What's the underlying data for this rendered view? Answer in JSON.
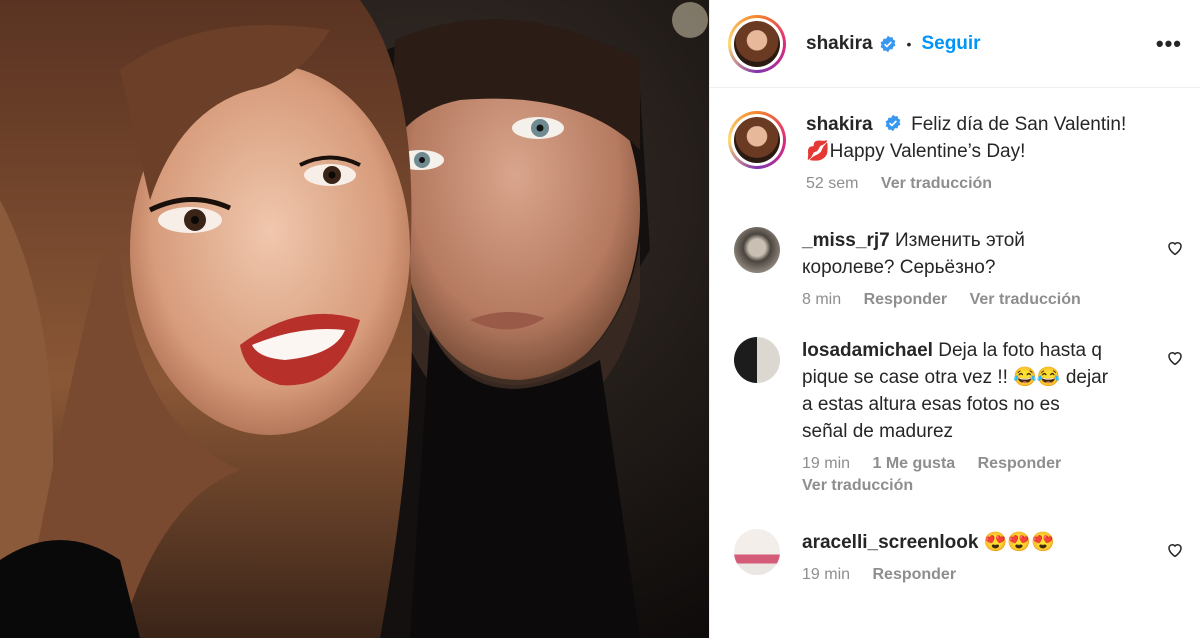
{
  "post": {
    "username": "shakira",
    "follow_label": "Seguir",
    "separator": "•",
    "more_label": "•••"
  },
  "caption": {
    "username": "shakira",
    "text_line1": "Feliz día de San Valentin!",
    "text_line2": "💋Happy Valentine’s Day!",
    "age": "52 sem",
    "translate": "Ver traducción"
  },
  "comments": [
    {
      "username": "_miss_rj7",
      "text_line1": "Изменить этой",
      "text_line2": "королеве? Серьёзно?",
      "age": "8 min",
      "reply": "Responder",
      "translate": "Ver traducción"
    },
    {
      "username": "losadamichael",
      "text_line1": "Deja la foto hasta q",
      "text_line2": "pique se case otra vez !! 😂😂 dejar",
      "text_line3": "a estas altura esas fotos no es",
      "text_line4": "señal de madurez",
      "age": "19 min",
      "likes": "1 Me gusta",
      "reply": "Responder",
      "translate": "Ver traducción"
    },
    {
      "username": "aracelli_screenlook",
      "text": "😍😍😍",
      "age": "19 min",
      "reply": "Responder"
    }
  ]
}
